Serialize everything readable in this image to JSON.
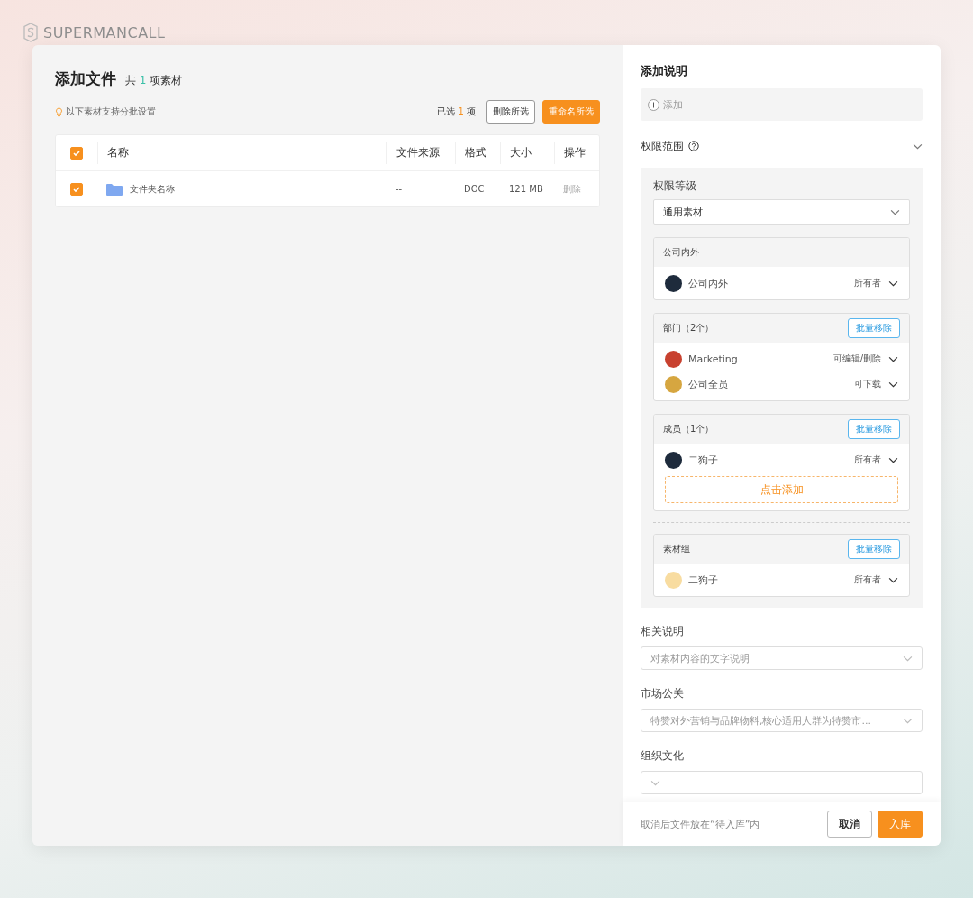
{
  "brand": {
    "name": "SUPERMANCALL"
  },
  "files": {
    "title": "添加文件",
    "count_prefix": "共",
    "count": "1",
    "count_suffix": "项素材",
    "hint": "以下素材支持分批设置",
    "selected_prefix": "已选",
    "selected_count": "1",
    "selected_suffix": "项",
    "delete_button": "删除所选",
    "rename_button": "重命名所选",
    "table": {
      "all_checked": true,
      "columns": [
        "名称",
        "文件来源",
        "格式",
        "大小",
        "操作"
      ],
      "rows": [
        {
          "checked": true,
          "name": "文件夹名称",
          "source": "--",
          "format": "DOC",
          "size": "121 MB",
          "action": "删除"
        }
      ]
    }
  },
  "details": {
    "title": "添加说明",
    "add_label": "添加",
    "scope_label": "权限范围",
    "level_label": "权限等级",
    "level_value": "通用素材",
    "groups": [
      {
        "title": "公司内外",
        "members": [
          {
            "name": "公司内外",
            "role": "所有者",
            "color": "#1e2b3c"
          }
        ]
      },
      {
        "title": "部门（2个）",
        "remove_button": "批量移除",
        "members": [
          {
            "name": "Marketing",
            "role": "可编辑/删除",
            "color": "#c8412f"
          },
          {
            "name": "公司全员",
            "role": "可下载",
            "color": "#d6a640"
          }
        ]
      },
      {
        "title": "成员（1个）",
        "remove_button": "批量移除",
        "members": [
          {
            "name": "二狗子",
            "role": "所有者",
            "color": "#1e2b3c"
          }
        ],
        "add_button": "点击添加"
      },
      {
        "title": "素材组",
        "remove_button": "批量移除",
        "divider_before": true,
        "members": [
          {
            "name": "二狗子",
            "role": "所有者",
            "color": "#f8dca0"
          }
        ]
      }
    ],
    "fields": [
      {
        "label": "相关说明",
        "placeholder": "对素材内容的文字说明"
      },
      {
        "label": "市场公关",
        "placeholder": "特赞对外营销与品牌物料,核心适用人群为特赞市..."
      },
      {
        "label": "组织文化"
      }
    ],
    "footer": {
      "note": "取消后文件放在“待入库”内",
      "cancel_button": "取消",
      "submit_button": "入库"
    }
  }
}
